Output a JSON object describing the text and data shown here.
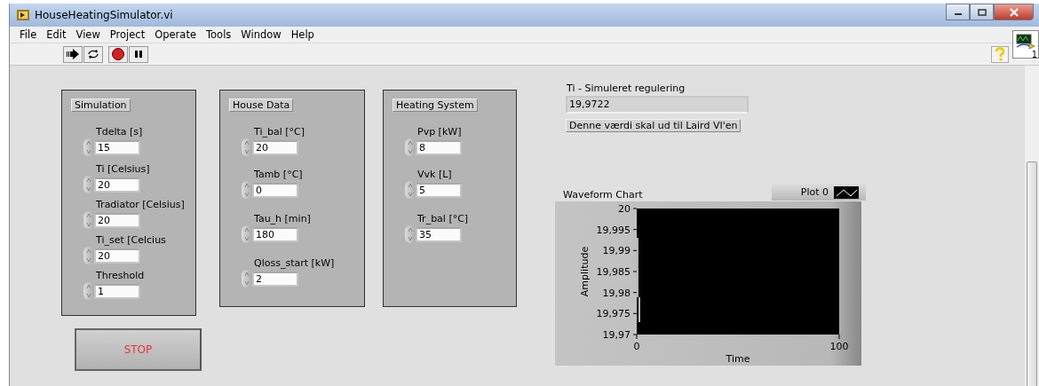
{
  "window": {
    "title": "HouseHeatingSimulator.vi"
  },
  "menu": [
    "File",
    "Edit",
    "View",
    "Project",
    "Operate",
    "Tools",
    "Window",
    "Help"
  ],
  "groups": [
    {
      "title": "Simulation",
      "controls": [
        {
          "label": "Tdelta [s]",
          "value": "15"
        },
        {
          "label": "Ti [Celsius]",
          "value": "20"
        },
        {
          "label": "Tradiator [Celsius]",
          "value": "20"
        },
        {
          "label": "Ti_set [Celcius",
          "value": "20"
        },
        {
          "label": "Threshold",
          "value": "1"
        }
      ]
    },
    {
      "title": "House Data",
      "controls": [
        {
          "label": "Ti_bal [°C]",
          "value": "20"
        },
        {
          "label": "Tamb [°C]",
          "value": "0"
        },
        {
          "label": "Tau_h [min]",
          "value": "180"
        },
        {
          "label": "Qloss_start [kW]",
          "value": "2"
        }
      ]
    },
    {
      "title": "Heating System",
      "controls": [
        {
          "label": "Pvp [kW]",
          "value": "8"
        },
        {
          "label": "Vvk [L]",
          "value": "5"
        },
        {
          "label": "Tr_bal [°C]",
          "value": "35"
        }
      ]
    }
  ],
  "indicator": {
    "label": "Ti - Simuleret regulering",
    "value": "19,9722",
    "note": "Denne værdi skal ud til Laird VI'en"
  },
  "stop_button": {
    "label": "STOP"
  },
  "vi_icon": {
    "badge": "1"
  },
  "chart": {
    "label": "Waveform Chart",
    "legend": "Plot 0",
    "x_title": "Time",
    "y_title": "Amplitude",
    "y_ticks": [
      "20",
      "19,995",
      "19,99",
      "19,985",
      "19,98",
      "19,975",
      "19,97"
    ],
    "x_ticks": [
      "0",
      "100"
    ]
  }
}
